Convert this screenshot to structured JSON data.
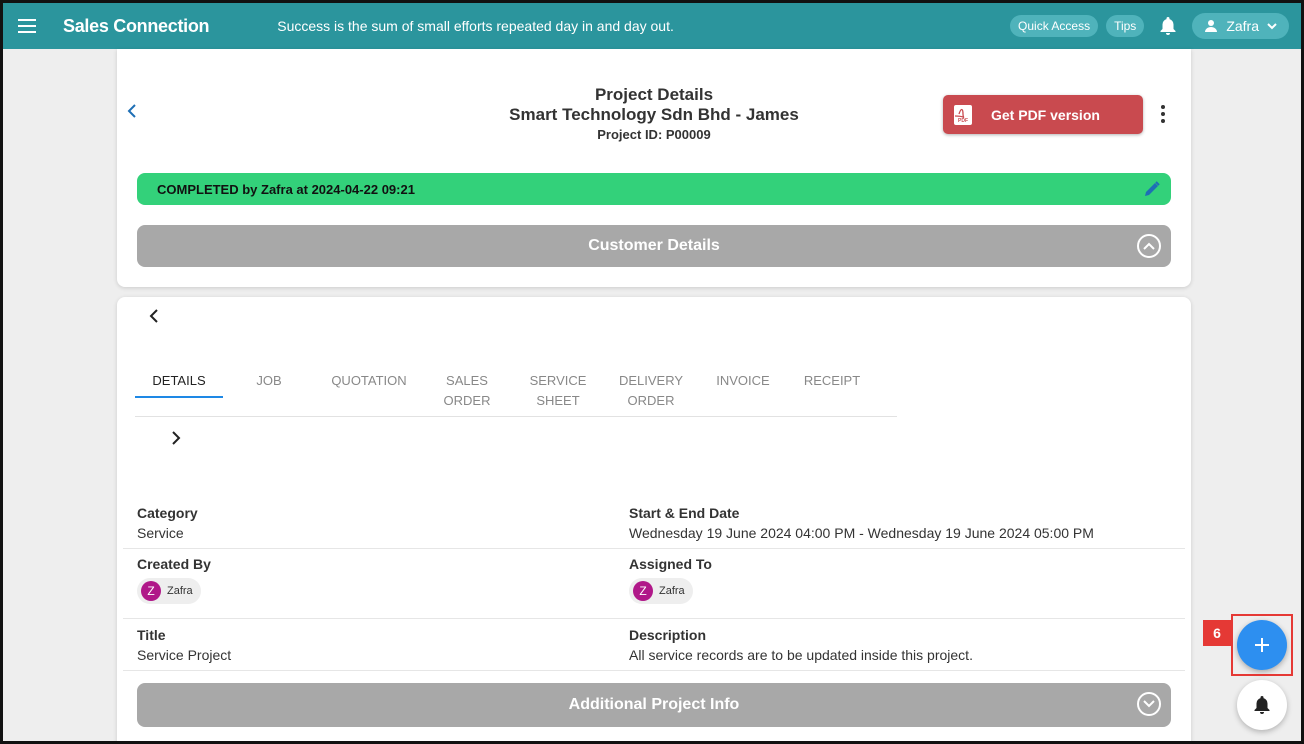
{
  "app": {
    "title": "Sales Connection",
    "motto": "Success is the sum of small efforts repeated day in and day out."
  },
  "topbar": {
    "quick_access": "Quick Access",
    "tips": "Tips",
    "user": "Zafra"
  },
  "project": {
    "heading": "Project Details",
    "customer": "Smart Technology Sdn Bhd - James",
    "project_id": "Project ID: P00009",
    "pdf_button": "Get PDF version"
  },
  "status": {
    "text": "COMPLETED by Zafra at 2024-04-22 09:21",
    "color": "#33d17a"
  },
  "sections": {
    "customer_details": "Customer Details",
    "additional_info": "Additional Project Info"
  },
  "tabs": [
    {
      "label": "DETAILS",
      "active": true
    },
    {
      "label": "JOB"
    },
    {
      "label": "QUOTATION"
    },
    {
      "label": "SALES\nORDER"
    },
    {
      "label": "SERVICE\nSHEET"
    },
    {
      "label": "DELIVERY\nORDER"
    },
    {
      "label": "INVOICE"
    },
    {
      "label": "RECEIPT"
    }
  ],
  "details": {
    "category_label": "Category",
    "category_value": "Service",
    "dates_label": "Start & End Date",
    "dates_value": "Wednesday 19 June 2024 04:00 PM - Wednesday 19 June 2024 05:00 PM",
    "created_by_label": "Created By",
    "created_by": {
      "initial": "Z",
      "name": "Zafra"
    },
    "assigned_to_label": "Assigned To",
    "assigned_to": {
      "initial": "Z",
      "name": "Zafra"
    },
    "title_label": "Title",
    "title_value": "Service Project",
    "description_label": "Description",
    "description_value": "All service records are to be updated inside this project."
  },
  "annotation": {
    "badge": "6"
  },
  "colors": {
    "brand": "#2b959d",
    "pdf": "#c94a4f",
    "fab": "#2d8ff0",
    "avatar": "#b01889",
    "highlight": "#e53935"
  }
}
